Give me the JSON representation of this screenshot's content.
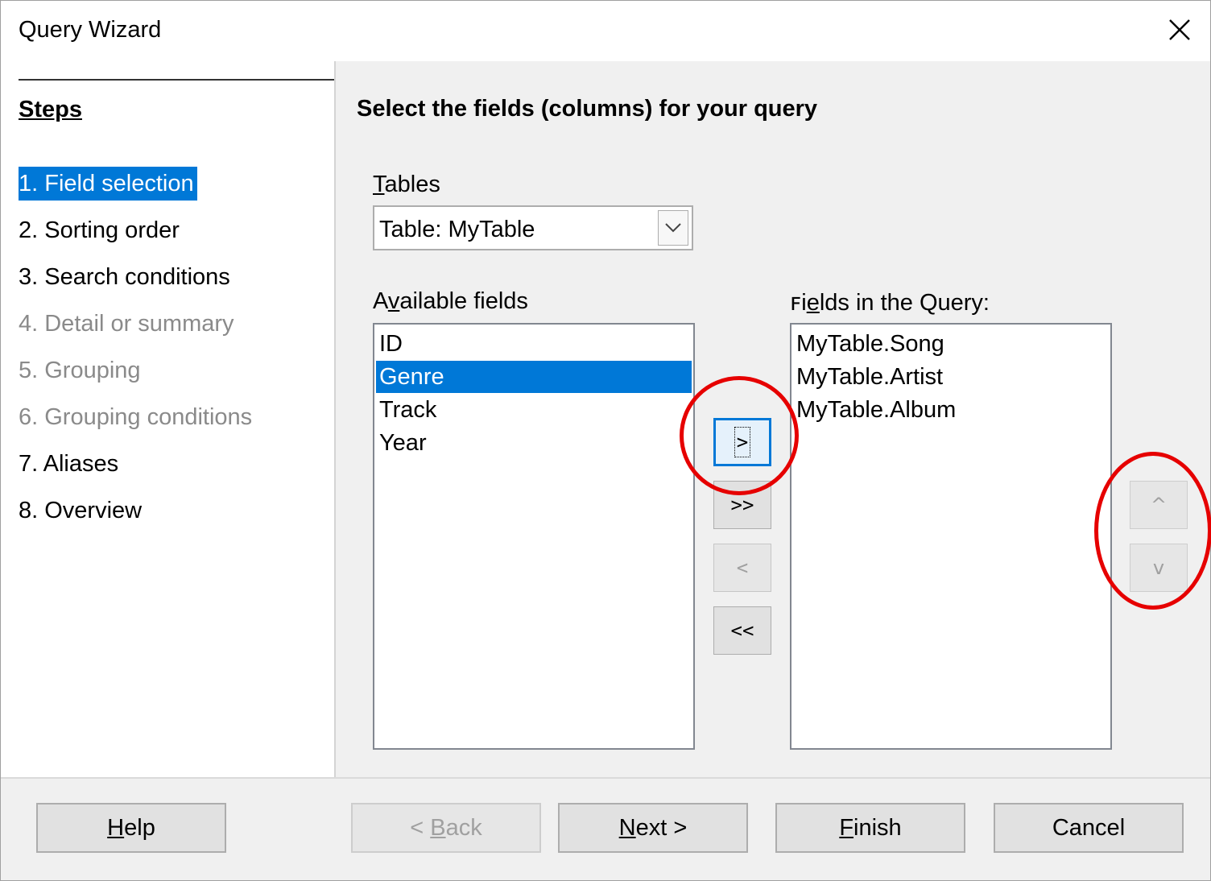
{
  "window": {
    "title": "Query Wizard"
  },
  "sidebar": {
    "heading": "Steps",
    "steps": [
      {
        "label": "1. Field selection",
        "state": "active"
      },
      {
        "label": "2. Sorting order",
        "state": "enabled"
      },
      {
        "label": "3. Search conditions",
        "state": "enabled"
      },
      {
        "label": "4. Detail or summary",
        "state": "disabled"
      },
      {
        "label": "5. Grouping",
        "state": "disabled"
      },
      {
        "label": "6. Grouping conditions",
        "state": "disabled"
      },
      {
        "label": "7. Aliases",
        "state": "enabled"
      },
      {
        "label": "8. Overview",
        "state": "enabled"
      }
    ]
  },
  "main": {
    "heading": "Select the fields (columns) for your query",
    "tables": {
      "label_mnemonic": "T",
      "label_rest": "ables",
      "selected": "Table: MyTable"
    },
    "available": {
      "label_pre": "A",
      "label_mnemonic": "v",
      "label_rest": "ailable fields",
      "items": [
        "ID",
        "Genre",
        "Track",
        "Year"
      ],
      "selected_index": 1
    },
    "query": {
      "label_pre": "ꜰi",
      "label_mnemonic": "e",
      "label_rest": "lds in the Query:",
      "items": [
        "MyTable.Song",
        "MyTable.Artist",
        "MyTable.Album"
      ]
    },
    "move_buttons": {
      "add": ">",
      "add_all": ">>",
      "remove": "<",
      "remove_all": "<<"
    },
    "order_buttons": {
      "up": "^",
      "down": "v"
    }
  },
  "footer": {
    "help": {
      "mnemonic": "H",
      "rest": "elp"
    },
    "back": {
      "pre": "< ",
      "mnemonic": "B",
      "rest": "ack"
    },
    "next": {
      "mnemonic": "N",
      "rest": "ext >"
    },
    "finish": {
      "mnemonic": "F",
      "rest": "inish"
    },
    "cancel": {
      "label": "Cancel"
    }
  },
  "colors": {
    "selection": "#0078d7",
    "annotation": "#e60000",
    "disabled_text": "#8a8a8a"
  },
  "icons": [
    "close-icon",
    "chevron-down-icon"
  ]
}
